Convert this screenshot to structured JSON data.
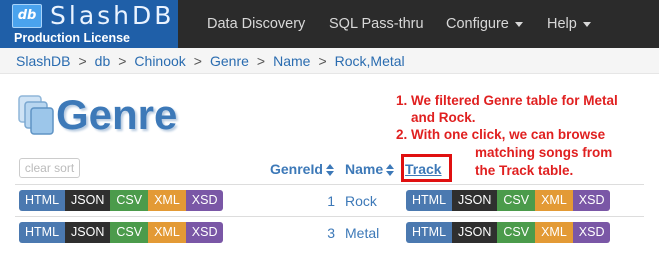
{
  "app": {
    "logo_text": "db",
    "name": "SlashDB",
    "license": "Production License"
  },
  "nav": {
    "items": [
      "Data Discovery",
      "SQL Pass-thru",
      "Configure",
      "Help"
    ]
  },
  "breadcrumb": [
    "SlashDB",
    "db",
    "Chinook",
    "Genre",
    "Name",
    "Rock,Metal"
  ],
  "page": {
    "title": "Genre"
  },
  "annotation": {
    "line1": "1. We filtered Genre table for Metal",
    "line2": "and Rock.",
    "line3": "2. With one click, we can browse",
    "line4": "matching songs from",
    "line5": "the Track table.",
    "color": "#e02020"
  },
  "table": {
    "clear_sort_label": "clear sort",
    "columns": {
      "genre_id": "GenreId",
      "name": "Name",
      "track": "Track"
    },
    "rows": [
      {
        "genre_id": "1",
        "name": "Rock"
      },
      {
        "genre_id": "3",
        "name": "Metal"
      }
    ]
  },
  "formats": [
    {
      "label": "HTML",
      "color": "#4b79b0"
    },
    {
      "label": "JSON",
      "color": "#2f2f2f"
    },
    {
      "label": "CSV",
      "color": "#4b9b4b"
    },
    {
      "label": "XML",
      "color": "#e39a35"
    },
    {
      "label": "XSD",
      "color": "#7a57a6"
    }
  ],
  "colors": {
    "navbar": "#2b2b2b",
    "brand": "#1f5fa8",
    "link": "#3d79b8",
    "highlight": "#e01010"
  }
}
